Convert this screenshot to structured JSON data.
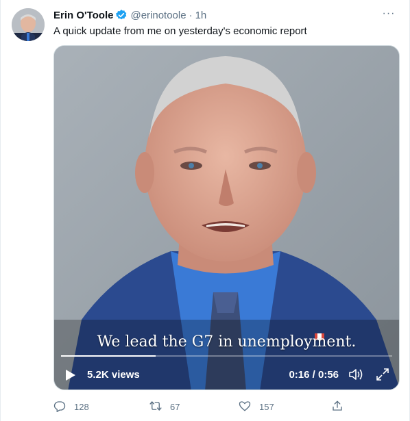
{
  "tweet": {
    "display_name": "Erin O'Toole",
    "handle": "@erinotoole",
    "separator": "·",
    "time": "1h",
    "text": "A quick update from me on yesterday's economic report",
    "more_label": "···"
  },
  "video": {
    "caption": "We lead the G7 in unemployment.",
    "views": "5.2K views",
    "timecode": "0:16 / 0:56",
    "progress": 0.285
  },
  "actions": {
    "reply_count": "128",
    "retweet_count": "67",
    "like_count": "157"
  },
  "colors": {
    "verified": "#1da1f2",
    "muted_text": "#5b7083",
    "suit": "#2b4a8f",
    "shirt": "#3a7ad6"
  },
  "icons": {
    "verified": "verified-badge-icon",
    "more": "more-icon",
    "play": "play-icon",
    "volume": "volume-icon",
    "expand": "expand-icon",
    "reply": "reply-icon",
    "retweet": "retweet-icon",
    "like": "heart-icon",
    "share": "share-icon"
  }
}
